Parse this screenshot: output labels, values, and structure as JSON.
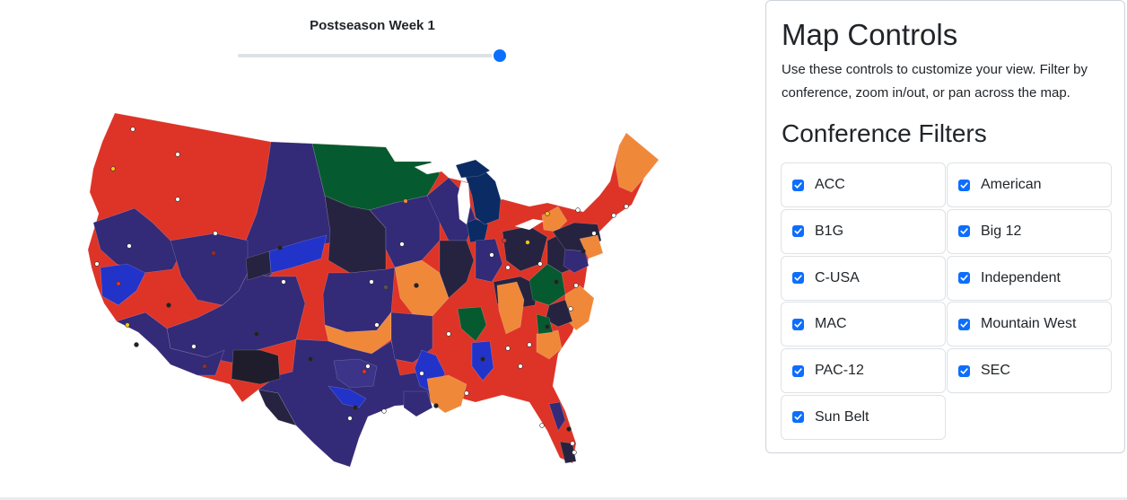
{
  "week": {
    "label": "Postseason Week 1",
    "value_fraction": 1.0
  },
  "panel": {
    "title": "Map Controls",
    "description": "Use these controls to customize your view. Filter by conference, zoom in/out, or pan across the map.",
    "filters_title": "Conference Filters",
    "filters": [
      {
        "label": "ACC",
        "checked": true
      },
      {
        "label": "American",
        "checked": true
      },
      {
        "label": "B1G",
        "checked": true
      },
      {
        "label": "Big 12",
        "checked": true
      },
      {
        "label": "C-USA",
        "checked": true
      },
      {
        "label": "Independent",
        "checked": true
      },
      {
        "label": "MAC",
        "checked": true
      },
      {
        "label": "Mountain West",
        "checked": true
      },
      {
        "label": "PAC-12",
        "checked": true
      },
      {
        "label": "SEC",
        "checked": true
      },
      {
        "label": "Sun Belt",
        "checked": true
      }
    ]
  },
  "colors": {
    "accent": "#0d6efd",
    "red": "#dd3427",
    "navy": "#332a78",
    "dark": "#262340",
    "green": "#065a2f",
    "orange": "#f0883a",
    "blue": "#2233c9",
    "michigan": "#0b2b64"
  }
}
